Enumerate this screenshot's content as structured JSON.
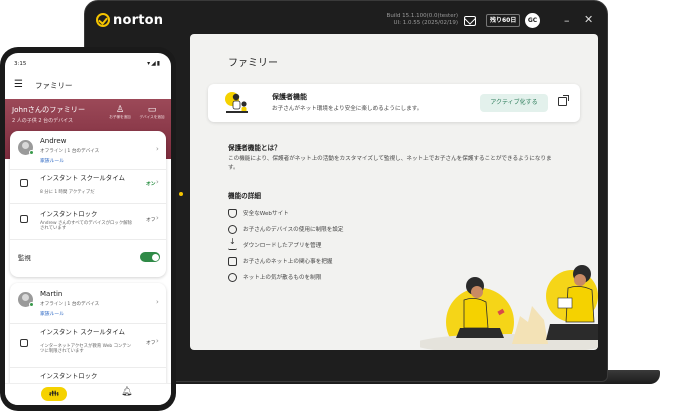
{
  "laptop": {
    "brand": "norton",
    "build_line1": "Build 15.1.100(0.0(tester)",
    "build_line2": "UI: 1.0.55 (2025/02/19)",
    "trial_badge": "残り60日",
    "user_initials": "GC",
    "window_min": "–",
    "window_close": "✕",
    "page_title": "ファミリー",
    "card": {
      "title": "保護者機能",
      "subtitle": "お子さんがネット環境をより安全に楽しめるようにします。",
      "activate_button": "アクティブ化する"
    },
    "what_is": {
      "heading": "保護者機能とは？",
      "body": "この機能により、保護者がネット上の活動をカスタマイズして監視し、ネット上でお子さんを保護することができるようになります。"
    },
    "details": {
      "heading": "機能の詳細",
      "features": [
        {
          "icon": "shield-icon",
          "label": "安全なWebサイト"
        },
        {
          "icon": "device-time-icon",
          "label": "お子さんのデバイスの使用に制限を設定"
        },
        {
          "icon": "download-icon",
          "label": "ダウンロードしたアプリを管理"
        },
        {
          "icon": "search-phone-icon",
          "label": "お子さんのネット上の関心事を把握"
        },
        {
          "icon": "location-icon",
          "label": "ネット上の気が散るものを制限"
        }
      ]
    }
  },
  "phone": {
    "status_time": "3:15",
    "app_title": "ファミリー",
    "family": {
      "name": "Johnさんのファミリー",
      "summary": "2 人の子供  2 台のデバイス",
      "add_child_label": "お子様を追加",
      "add_device_label": "デバイスを追加"
    },
    "children": [
      {
        "name": "Andrew",
        "status": "オフライン | 1 台のデバイス",
        "rule_link": "家族ルール",
        "rows": [
          {
            "title": "インスタント スクールタイム",
            "sub": "8 分に 1 時間  アクティブだ",
            "state": "オン"
          },
          {
            "title": "インスタントロック",
            "sub": "Andrew さんのすべてのデバイスがロック解除されています",
            "state": "オフ"
          }
        ],
        "monitor_label": "監視"
      },
      {
        "name": "Martin",
        "status": "オフライン | 1 台のデバイス",
        "rule_link": "家族ルール",
        "rows": [
          {
            "title": "インスタント スクールタイム",
            "sub": "インターネットアクセスが教育 Web コンテンツに制限されています",
            "state": "オフ"
          },
          {
            "title": "インスタントロック",
            "sub": "",
            "state": ""
          }
        ]
      }
    ]
  }
}
